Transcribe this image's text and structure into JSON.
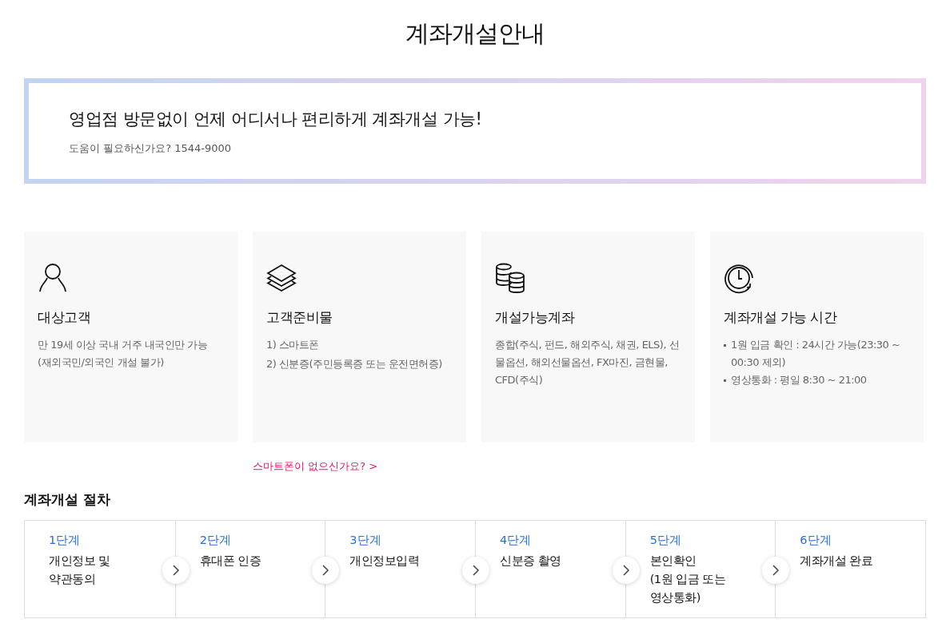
{
  "page_title": "계좌개설안내",
  "banner": {
    "headline": "영업점 방문없이 언제 어디서나 편리하게 계좌개설 가능!",
    "help": "도움이 필요하신가요? 1544-9000"
  },
  "cards": [
    {
      "title": "대상고객",
      "kind": "text",
      "lines": [
        "만 19세 이상 국내 거주 내국인만 가능 (재외국민/외국인 개설 불가)"
      ]
    },
    {
      "title": "고객준비물",
      "kind": "list",
      "lines": [
        "1) 스마트폰",
        "2) 신분증(주민등록증 또는 운전면허증)"
      ]
    },
    {
      "title": "개설가능계좌",
      "kind": "text",
      "lines": [
        "종합(주식, 펀드, 해외주식, 채권, ELS), 선물옵션, 해외선물옵션, FX마진, 금현물, CFD(주식)"
      ]
    },
    {
      "title": "계좌개설 가능 시간",
      "kind": "bullets",
      "lines": [
        "1원 입금 확인 : 24시간 가능(23:30 ~ 00:30 제외)",
        "영상통화 : 평일 8:30 ~ 21:00"
      ]
    }
  ],
  "smartphone_link": "스마트폰이 없으신가요? >",
  "procedure": {
    "title": "계좌개설 절차",
    "steps": [
      {
        "step": "1단계",
        "label": "개인정보 및\n약관동의"
      },
      {
        "step": "2단계",
        "label": "휴대폰 인증"
      },
      {
        "step": "3단계",
        "label": "개인정보입력"
      },
      {
        "step": "4단계",
        "label": "신분증 촬영"
      },
      {
        "step": "5단계",
        "label": "본인확인\n(1원 입금 또는\n영상통화)"
      },
      {
        "step": "6단계",
        "label": "계좌개설 완료"
      }
    ]
  }
}
